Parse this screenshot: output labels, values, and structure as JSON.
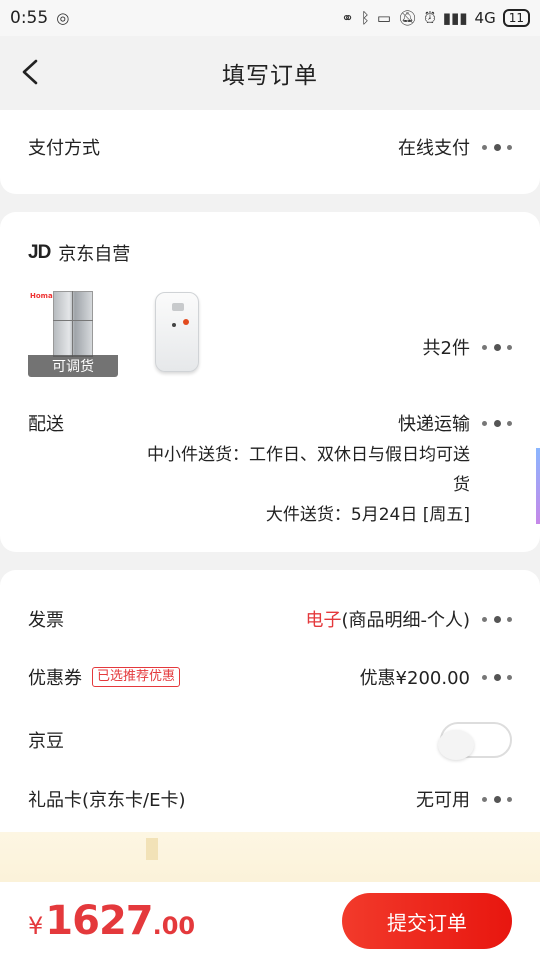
{
  "status_bar": {
    "time": "0:55",
    "network": "4G",
    "battery": "11"
  },
  "header": {
    "title": "填写订单"
  },
  "payment": {
    "label": "支付方式",
    "value": "在线支付"
  },
  "store": {
    "logo": "JD",
    "name": "京东自营"
  },
  "products": {
    "tag": "可调货",
    "brand": "Homa",
    "count_text": "共2件"
  },
  "delivery": {
    "label": "配送",
    "method": "快递运输",
    "line1": "中小件送货：工作日、双休日与假日均可送",
    "line2": "货",
    "line3": "大件送货：5月24日 [周五]"
  },
  "invoice": {
    "label": "发票",
    "value_highlight": "电子",
    "value_rest": "(商品明细-个人)"
  },
  "coupon": {
    "label": "优惠券",
    "tag": "已选推荐优惠",
    "value": "优惠¥200.00"
  },
  "jingdou": {
    "label": "京豆"
  },
  "gift_card": {
    "label": "礼品卡(京东卡/E卡)",
    "value": "无可用"
  },
  "footer": {
    "currency": "¥",
    "price_int": "1627",
    "price_dec": ".00",
    "submit_label": "提交订单"
  },
  "colors": {
    "accent": "#e4393c"
  }
}
